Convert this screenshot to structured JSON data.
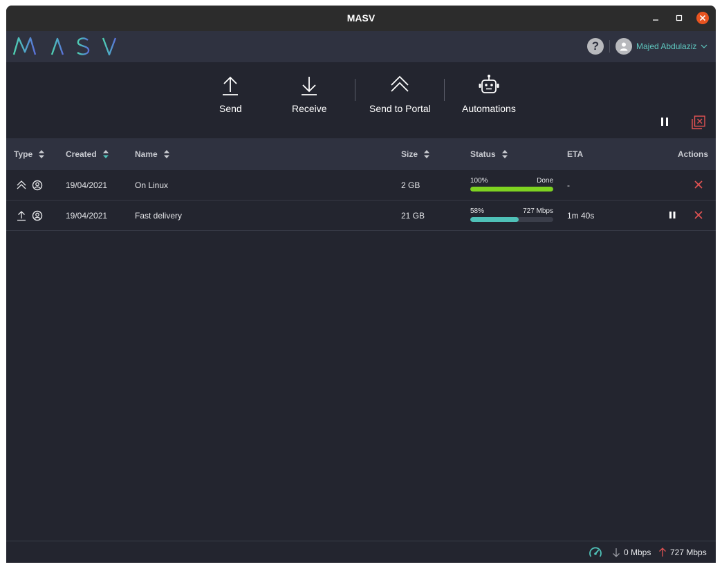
{
  "window": {
    "title": "MASV"
  },
  "brand": {
    "logo_letters": "MASV"
  },
  "user": {
    "name": "Majed Abdulaziz"
  },
  "help": {
    "label": "?"
  },
  "toolbar": {
    "send": "Send",
    "receive": "Receive",
    "send_to_portal": "Send to Portal",
    "automations": "Automations"
  },
  "table": {
    "headers": {
      "type": "Type",
      "created": "Created",
      "name": "Name",
      "size": "Size",
      "status": "Status",
      "eta": "ETA",
      "actions": "Actions"
    },
    "rows": [
      {
        "type_icon": "portal-icon",
        "created": "19/04/2021",
        "name": "On Linux",
        "size": "2 GB",
        "progress_label": "100%",
        "progress": 1.0,
        "status_text": "Done",
        "eta": "-",
        "bar_color": "#7ed321"
      },
      {
        "type_icon": "upload-icon",
        "created": "19/04/2021",
        "name": "Fast delivery",
        "size": "21 GB",
        "progress_label": "58%",
        "progress": 0.58,
        "status_text": "727 Mbps",
        "eta": "1m 40s",
        "bar_color": "#4fc1b8"
      }
    ]
  },
  "statusbar": {
    "download": "0 Mbps",
    "upload": "727 Mbps"
  },
  "colors": {
    "accent": "#5fc8c0",
    "cancel": "#e55353",
    "close_button": "#e95420"
  }
}
